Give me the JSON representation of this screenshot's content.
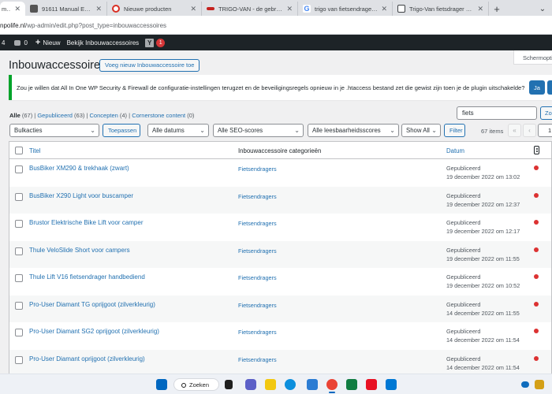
{
  "browser": {
    "tabs": [
      {
        "title": "mpo",
        "active": true,
        "color": "#e4572e"
      },
      {
        "title": "91611 Manual Enduro EM2",
        "active": false,
        "color": "#555555"
      },
      {
        "title": "Nieuwe producten",
        "active": false,
        "color": "#d93025"
      },
      {
        "title": "TRIGO-VAN - de gebruiksv",
        "active": false,
        "color": "#c5221f"
      },
      {
        "title": "trigo van fietsendrager - Go",
        "active": false,
        "color": "#4285f4"
      },
      {
        "title": "Trigo-Van fietsdrager van S",
        "active": false,
        "color": "#3c4043"
      }
    ],
    "url_host": "npolife.nl",
    "url_path": "/wp-admin/edit.php?post_type=inbouwaccessoires"
  },
  "adminbar": {
    "count_left": "4",
    "comments": "0",
    "new_label": "Nieuw",
    "view_label": "Bekijk Inbouwaccessoires",
    "yoast_badge": "1"
  },
  "screen_options": "Schermopties",
  "page": {
    "title": "Inbouwaccessoires",
    "add_new": "Voeg nieuw Inbouwaccessoire toe"
  },
  "notice": {
    "text": "Zou je willen dat All In One WP Security & Firewall de configuratie-instellingen terugzet en de beveiligingsregels opnieuw in je .htaccess bestand zet die gewist zijn toen je de plugin uitschakelde?",
    "yes": "Ja"
  },
  "views": {
    "all": "Alle",
    "all_count": "(67)",
    "published": "Gepubliceerd",
    "published_count": "(63)",
    "drafts": "Concepten",
    "drafts_count": "(4)",
    "cornerstone": "Cornerstone content",
    "cornerstone_count": "(0)"
  },
  "search": {
    "value": "fiets",
    "button": "Zoe"
  },
  "filters": {
    "bulk": "Bulkacties",
    "apply": "Toepassen",
    "dates": "Alle datums",
    "seo": "Alle SEO-scores",
    "readability": "Alle leesbaarheidsscores",
    "show": "Show All",
    "filter": "Filter",
    "items": "67 items",
    "first": "«",
    "prev": "‹",
    "page": "1"
  },
  "table": {
    "col_title": "Titel",
    "col_category": "Inbouwaccessoire categorieën",
    "col_date": "Datum",
    "rows": [
      {
        "title": "BusBiker XM290 & trekhaak (zwart)",
        "category": "Fietsendragers",
        "status": "Gepubliceerd",
        "date": "19 december 2022 om 13:02"
      },
      {
        "title": "BusBiker X290 Light voor buscamper",
        "category": "Fietsendragers",
        "status": "Gepubliceerd",
        "date": "19 december 2022 om 12:37"
      },
      {
        "title": "Brustor Elektrische Bike Lift voor camper",
        "category": "Fietsendragers",
        "status": "Gepubliceerd",
        "date": "19 december 2022 om 12:17"
      },
      {
        "title": "Thule VeloSlide Short voor campers",
        "category": "Fietsendragers",
        "status": "Gepubliceerd",
        "date": "19 december 2022 om 11:55"
      },
      {
        "title": "Thule Lift V16 fietsendrager handbediend",
        "category": "Fietsendragers",
        "status": "Gepubliceerd",
        "date": "19 december 2022 om 10:52"
      },
      {
        "title": "Pro-User Diamant TG oprijgoot (zilverkleurig)",
        "category": "Fietsendragers",
        "status": "Gepubliceerd",
        "date": "14 december 2022 om 11:55"
      },
      {
        "title": "Pro-User Diamant SG2 oprijgoot (zilverkleurig)",
        "category": "Fietsendragers",
        "status": "Gepubliceerd",
        "date": "14 december 2022 om 11:54"
      },
      {
        "title": "Pro-User Diamant oprijgoot (zilverkleurig)",
        "category": "Fietsendragers",
        "status": "Gepubliceerd",
        "date": "14 december 2022 om 11:54"
      }
    ],
    "seo_color": "#dc3232"
  },
  "taskbar": {
    "search_label": "Zoeken"
  }
}
